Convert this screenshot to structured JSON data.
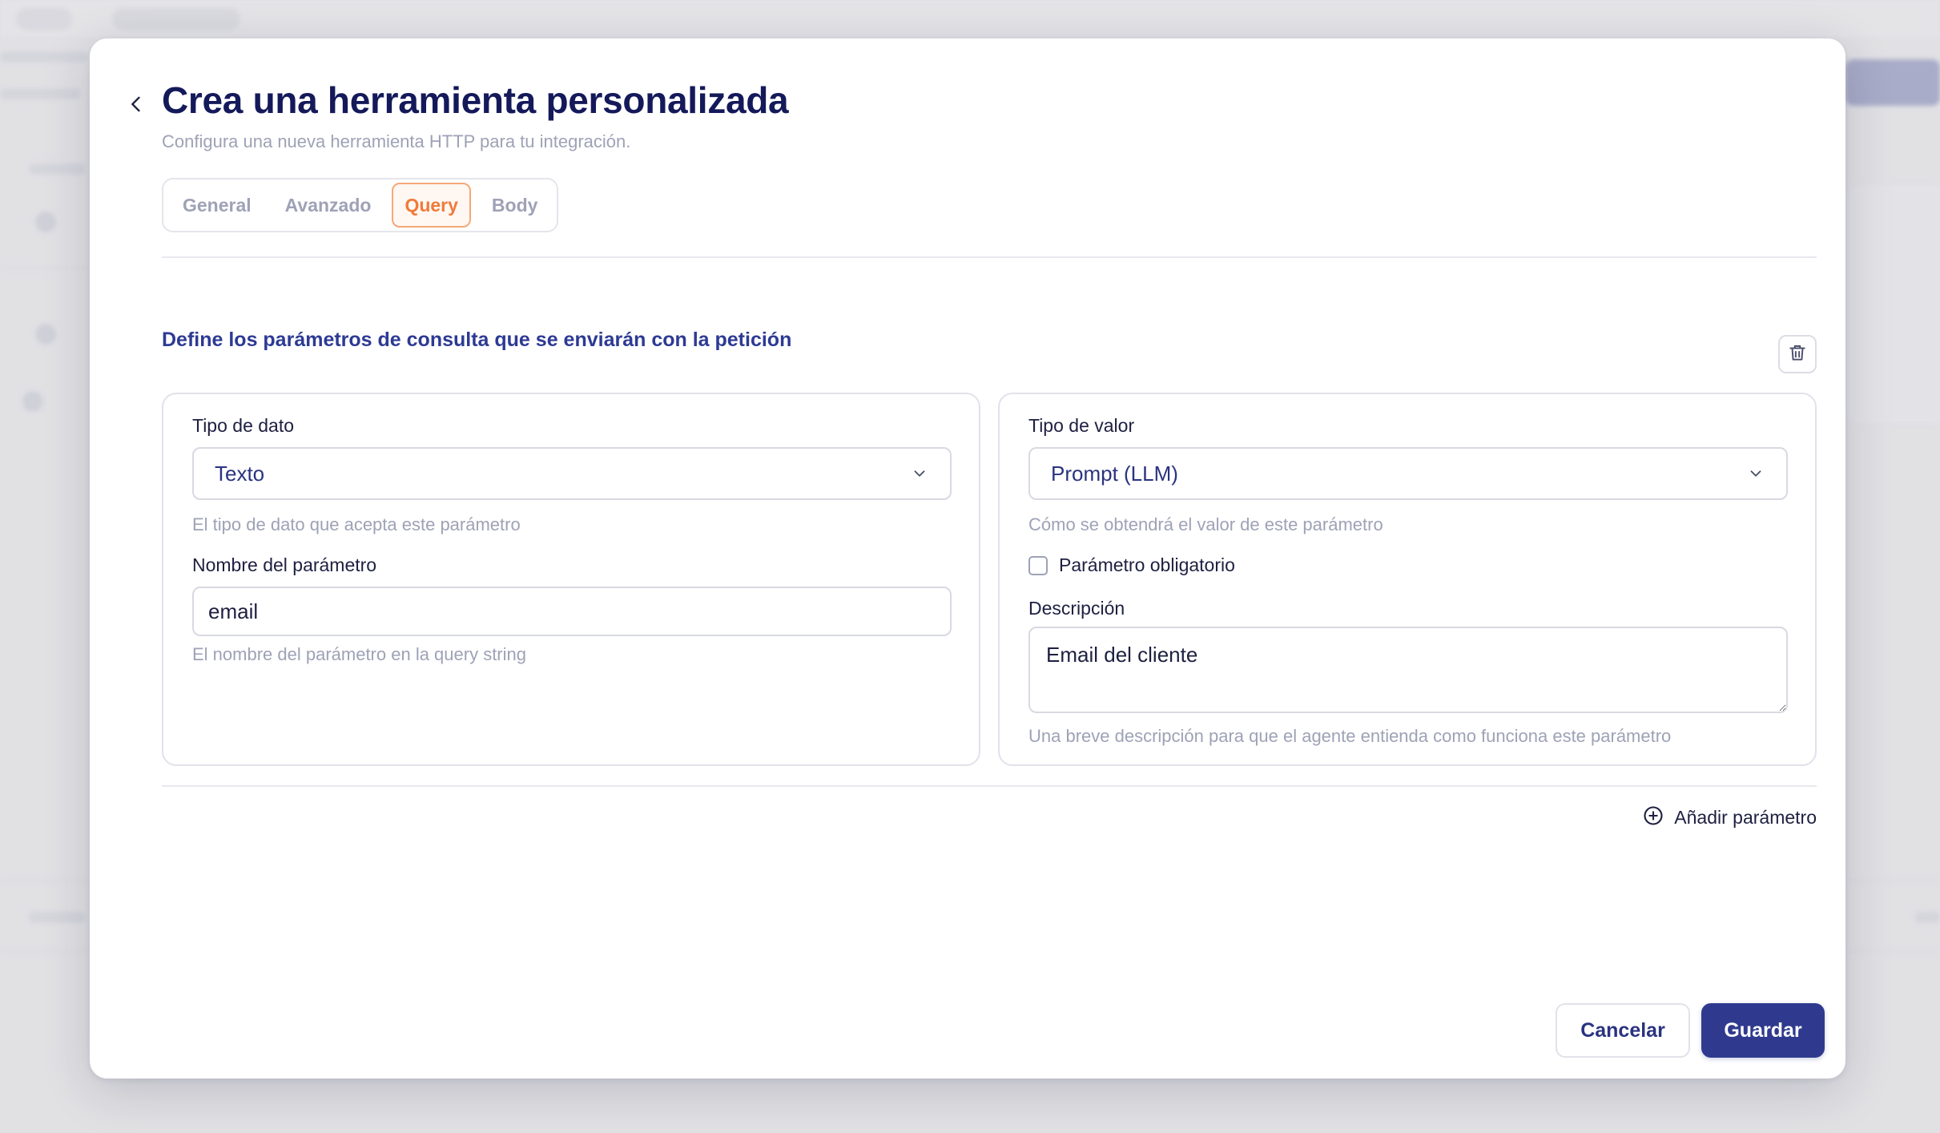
{
  "modal": {
    "title": "Crea una herramienta personalizada",
    "subtitle": "Configura una nueva herramienta HTTP para tu integración.",
    "back_icon": "chevron-left-icon"
  },
  "tabs": [
    {
      "label": "General",
      "active": false
    },
    {
      "label": "Avanzado",
      "active": false
    },
    {
      "label": "Query",
      "active": true
    },
    {
      "label": "Body",
      "active": false
    }
  ],
  "section": {
    "heading": "Define los parámetros de consulta que se enviarán con la petición",
    "delete_icon": "trash-icon"
  },
  "left_card": {
    "data_type_label": "Tipo de dato",
    "data_type_value": "Texto",
    "data_type_help": "El tipo de dato que acepta este parámetro",
    "param_name_label": "Nombre del parámetro",
    "param_name_value": "email",
    "param_name_help": "El nombre del parámetro en la query string"
  },
  "right_card": {
    "value_type_label": "Tipo de valor",
    "value_type_value": "Prompt (LLM)",
    "value_type_help": "Cómo se obtendrá el valor de este parámetro",
    "required_label": "Parámetro obligatorio",
    "required_checked": false,
    "description_label": "Descripción",
    "description_value": "Email del cliente",
    "description_help": "Una breve descripción para que el agente entienda como funciona este parámetro"
  },
  "add_param": {
    "label": "Añadir parámetro",
    "icon": "plus-circle-icon"
  },
  "footer": {
    "cancel_label": "Cancelar",
    "save_label": "Guardar"
  },
  "colors": {
    "primary": "#2f3a8f",
    "title": "#14195a",
    "accent_tab": "#f07a3a",
    "muted": "#9ea2b6"
  }
}
